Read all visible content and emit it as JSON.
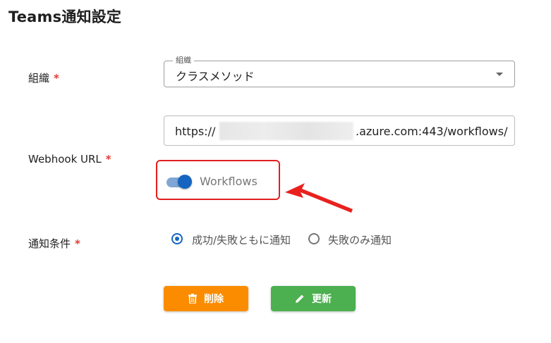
{
  "page": {
    "title": "Teams通知設定"
  },
  "fields": {
    "organization": {
      "label": "組織",
      "required_mark": "*",
      "legend": "組織",
      "selected_value": "クラスメソッド"
    },
    "webhook": {
      "label": "Webhook URL",
      "required_mark": "*",
      "url_prefix": "https://",
      "url_suffix": ".azure.com:443/workflows/",
      "toggle_label": "Workflows",
      "toggle_on": true
    },
    "notify_condition": {
      "label": "通知条件",
      "required_mark": "*",
      "options": [
        {
          "label": "成功/失敗ともに通知",
          "selected": true
        },
        {
          "label": "失敗のみ通知",
          "selected": false
        }
      ]
    }
  },
  "buttons": {
    "delete_label": "削除",
    "update_label": "更新"
  },
  "colors": {
    "delete": "#fb8c00",
    "update": "#4caf50",
    "accent": "#1565c0",
    "highlight": "#e0201e",
    "required": "#e53935"
  },
  "icons": {
    "delete": "trash-icon",
    "update": "pencil-icon",
    "select": "chevron-down-icon"
  }
}
